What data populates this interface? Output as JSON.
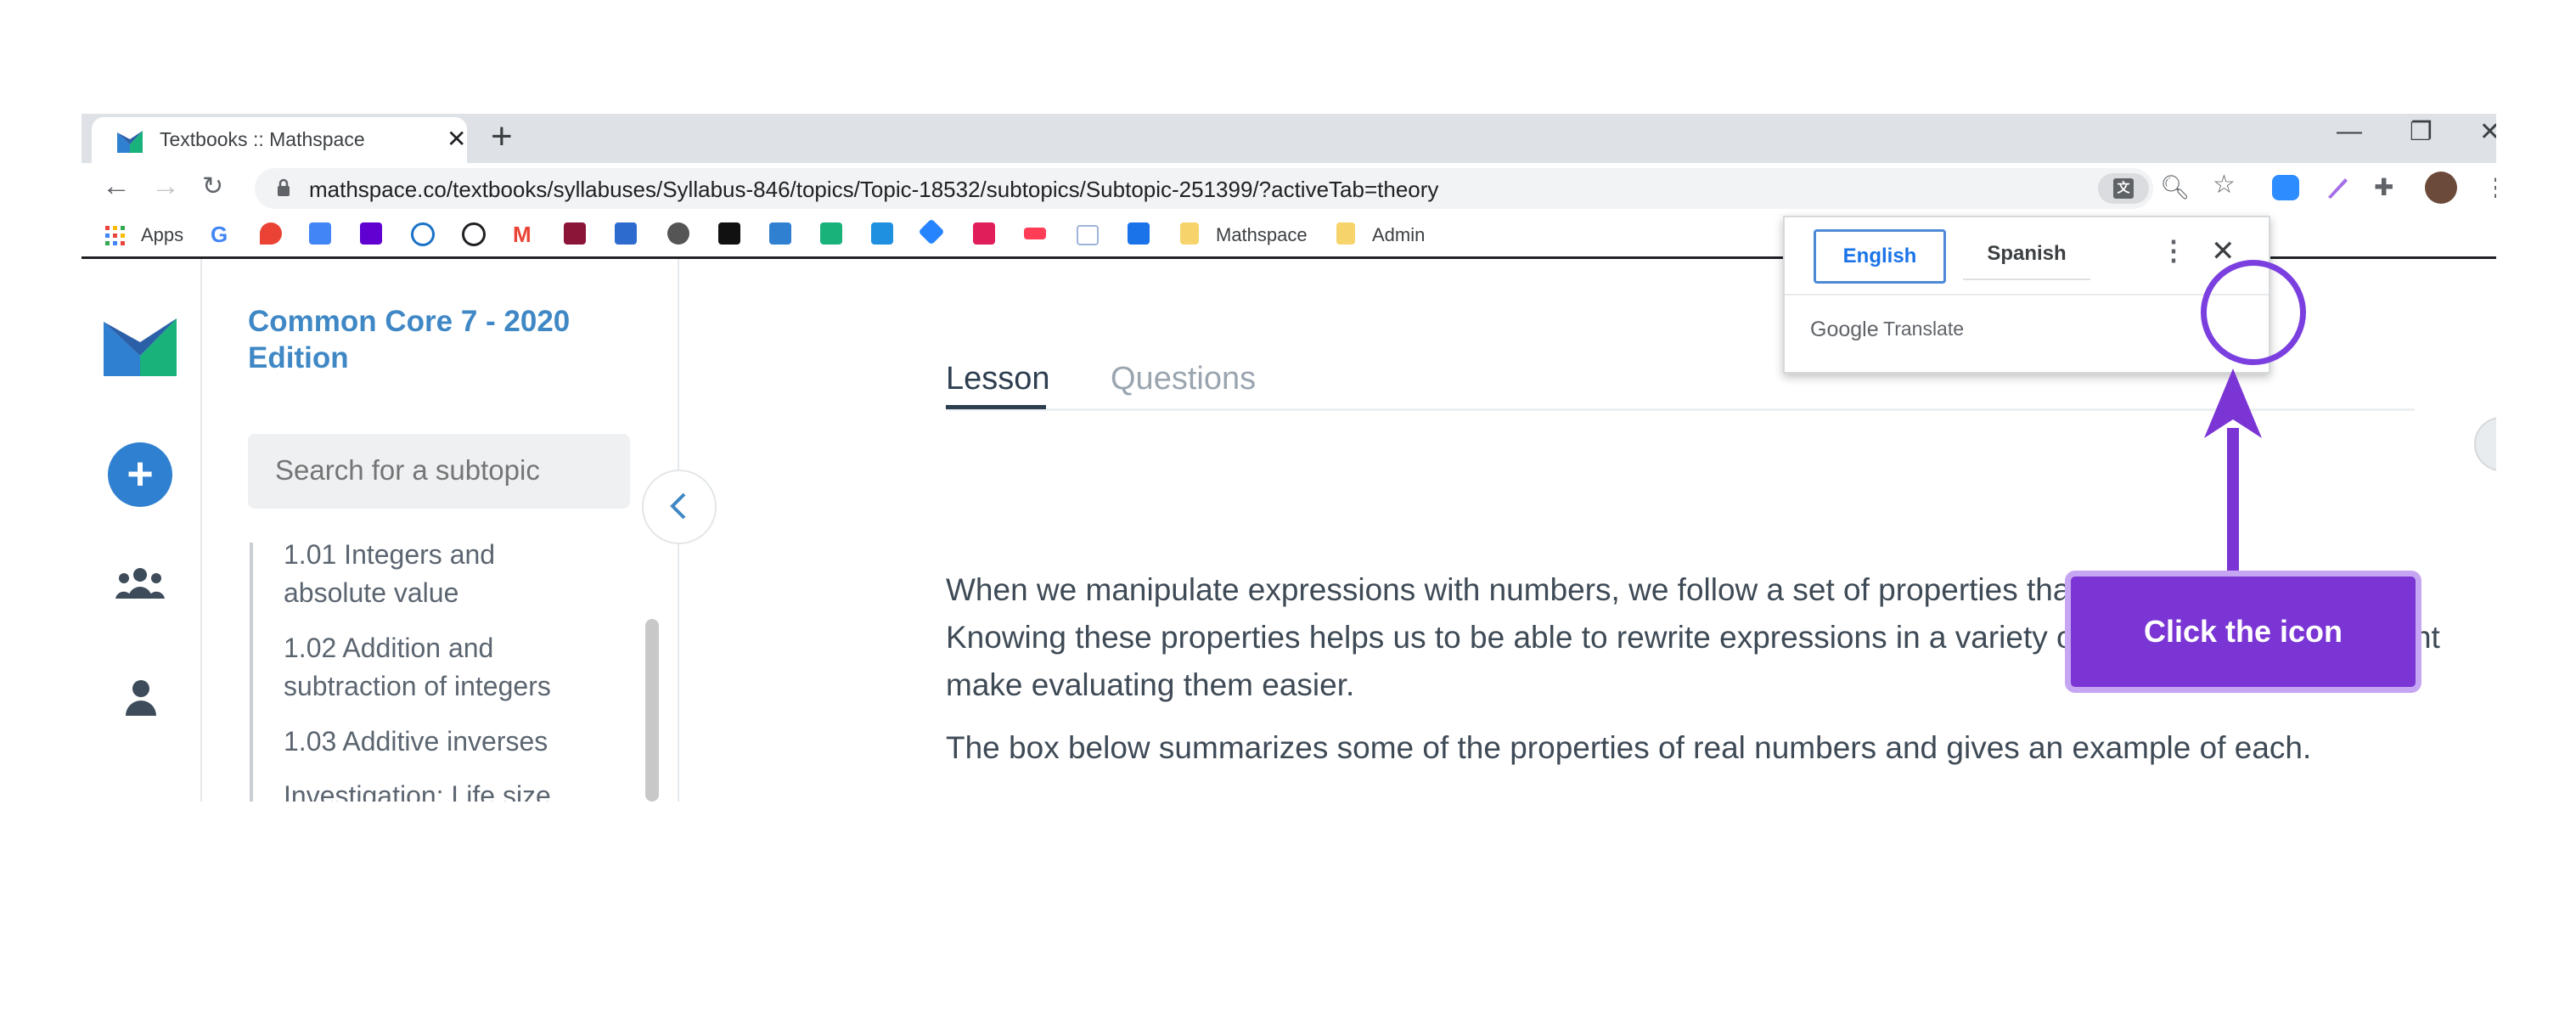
{
  "browser": {
    "tab_title": "Textbooks :: Mathspace",
    "tab_close": "✕",
    "new_tab": "+",
    "win_minimize": "—",
    "win_restore": "❐",
    "win_close": "✕",
    "url": "mathspace.co/textbooks/syllabuses/Syllabus-846/topics/Topic-18532/subtopics/Subtopic-251399/?activeTab=theory"
  },
  "bookmarks": {
    "apps_label": "Apps",
    "google_letter": "G",
    "folders": [
      "Mathspace",
      "Admin"
    ]
  },
  "sidebar": {
    "course_title": "Common Core 7 - 2020 Edition",
    "search_placeholder": "Search for a subtopic",
    "items": [
      "1.01 Integers and absolute value",
      "1.02 Addition and subtraction of integers",
      "1.03 Additive inverses",
      "Investigation: Life size"
    ]
  },
  "lesson": {
    "tabs": [
      "Lesson",
      "Questions"
    ],
    "paragraphs": [
      "When we manipulate expressions with numbers, we follow a set of properties that apply to all numbers. Knowing these properties helps us to be able to rewrite expressions in a variety of different ways, and might make evaluating them easier.",
      "The box below summarizes some of the properties of real numbers and gives an example of each."
    ]
  },
  "translate_popup": {
    "languages": [
      "English",
      "Spanish"
    ],
    "selected": "English",
    "brand_google": "Google",
    "brand_translate": "Translate"
  },
  "annotation": {
    "callout_text": "Click the icon",
    "color": "#7a35d4"
  },
  "colors": {
    "brand_blue": "#3f88c5",
    "tab_bar": "#dee1e6"
  }
}
